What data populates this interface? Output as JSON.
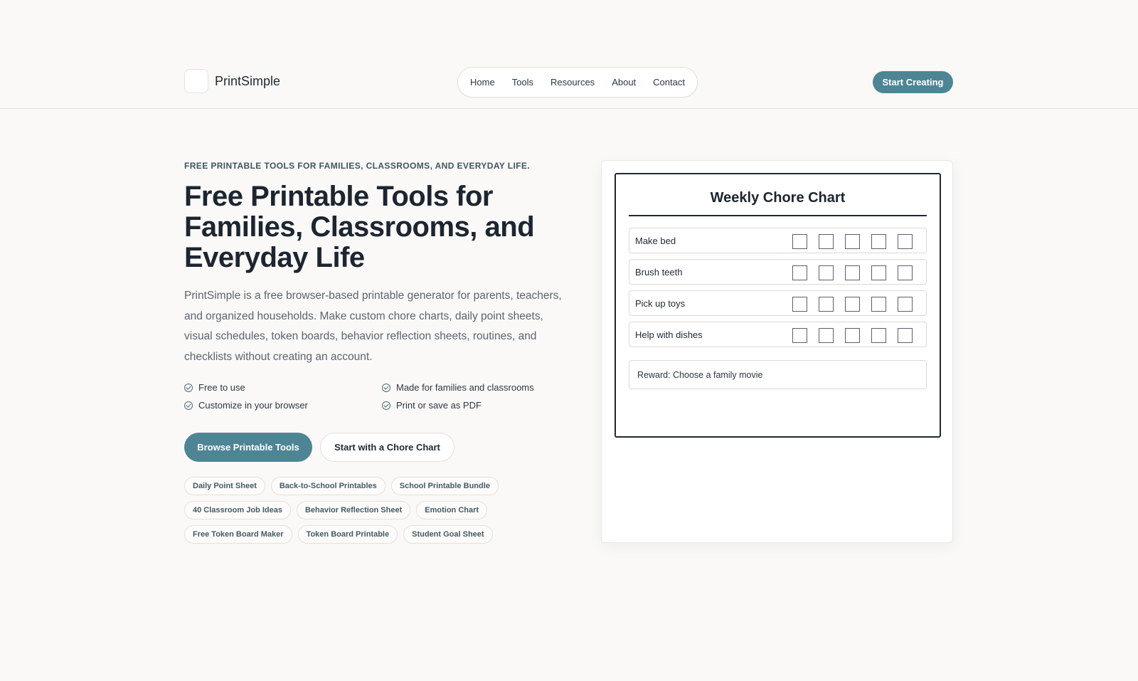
{
  "header": {
    "brand": "PrintSimple",
    "nav": [
      "Home",
      "Tools",
      "Resources",
      "About",
      "Contact"
    ],
    "cta": "Start Creating"
  },
  "hero": {
    "eyebrow": "FREE PRINTABLE TOOLS FOR FAMILIES, CLASSROOMS, AND EVERYDAY LIFE.",
    "headline": "Free Printable Tools for Families, Classrooms, and Everyday Life",
    "lede": "PrintSimple is a free browser-based printable generator for parents, teachers, and organized households. Make custom chore charts, daily point sheets, visual schedules, token boards, behavior reflection sheets, routines, and checklists without creating an account.",
    "features": [
      "Free to use",
      "Made for families and classrooms",
      "Customize in your browser",
      "Print or save as PDF"
    ],
    "primary_button": "Browse Printable Tools",
    "secondary_button": "Start with a Chore Chart",
    "chips": [
      [
        "Daily Point Sheet",
        "Back-to-School Printables",
        "School Printable Bundle"
      ],
      [
        "40 Classroom Job Ideas",
        "Behavior Reflection Sheet",
        "Emotion Chart"
      ],
      [
        "Free Token Board Maker",
        "Token Board Printable",
        "Student Goal Sheet"
      ]
    ]
  },
  "preview": {
    "title": "Weekly Chore Chart",
    "chores": [
      "Make bed",
      "Brush teeth",
      "Pick up toys",
      "Help with dishes"
    ],
    "boxes_per_row": 5,
    "reward": "Reward: Choose a family movie"
  }
}
